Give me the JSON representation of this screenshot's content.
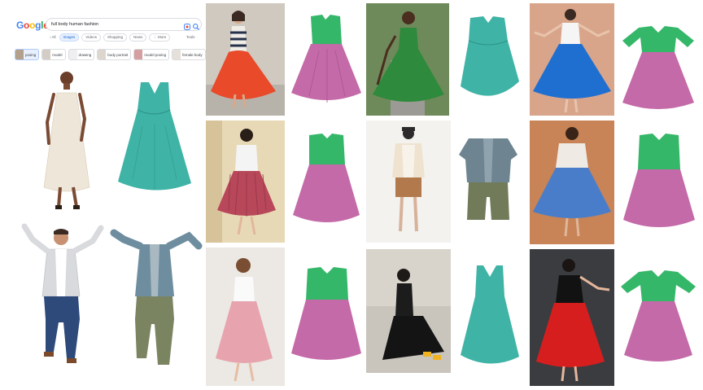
{
  "search": {
    "logo": "Google",
    "query": "full body human fashion",
    "tabs": [
      "All",
      "Images",
      "Videos",
      "Shopping",
      "News",
      "More"
    ],
    "active_tab": "Images",
    "tools_label": "Tools",
    "chips": [
      "posing",
      "model",
      "drawing",
      "body portrait",
      "model posing",
      "female body"
    ],
    "selected_chip": "posing"
  },
  "colors": {
    "google_blue": "#4285F4",
    "google_red": "#EA4335",
    "google_yellow": "#FBBC05",
    "google_green": "#34A853",
    "garment_teal": "#3fb3a6",
    "garment_pink": "#c46aa8",
    "garment_green": "#35b769",
    "garment_blue": "#1f6fd1",
    "garment_red": "#e23a2a"
  },
  "tiles": [
    {
      "kind": "photo",
      "subject": "woman in striped top and orange skirt"
    },
    {
      "kind": "garment",
      "garment": "green top and pink skirt"
    },
    {
      "kind": "photo",
      "subject": "woman in green dress"
    },
    {
      "kind": "garment",
      "garment": "teal dress"
    },
    {
      "kind": "photo",
      "subject": "woman in white top and blue skirt"
    },
    {
      "kind": "garment",
      "garment": "green top and pink skirt"
    },
    {
      "kind": "photo",
      "subject": "woman in white tee and red pleated skirt"
    },
    {
      "kind": "garment",
      "garment": "green top and pink skirt"
    },
    {
      "kind": "photo",
      "subject": "man in cream shirt and shorts"
    },
    {
      "kind": "garment",
      "garment": "grey shirt and olive shorts"
    },
    {
      "kind": "photo",
      "subject": "woman in lace top and blue skirt"
    },
    {
      "kind": "garment",
      "garment": "green top and pink skirt"
    },
    {
      "kind": "photo",
      "subject": "woman in white tee and pink skirt"
    },
    {
      "kind": "garment",
      "garment": "green top and pink skirt"
    },
    {
      "kind": "photo",
      "subject": "woman in black dress sitting"
    },
    {
      "kind": "garment",
      "garment": "teal dress"
    },
    {
      "kind": "photo",
      "subject": "woman in black top and red skirt"
    },
    {
      "kind": "garment",
      "garment": "green top and pink skirt"
    }
  ]
}
